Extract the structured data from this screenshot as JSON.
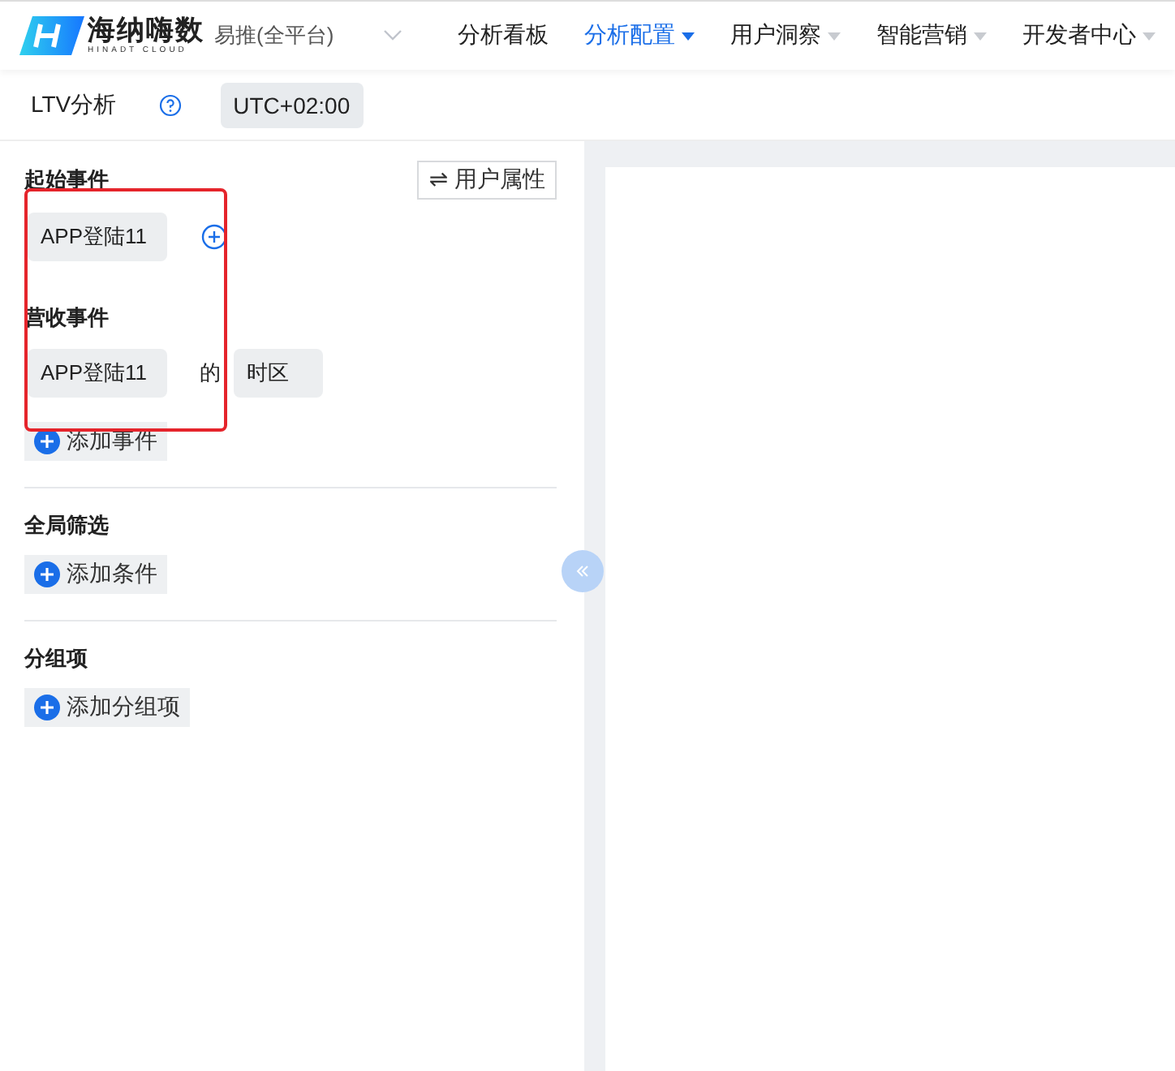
{
  "header": {
    "logo": {
      "name": "海纳嗨数",
      "subtitle": "HINADT CLOUD"
    },
    "project": "易推(全平台)",
    "nav": [
      {
        "label": "分析看板",
        "selected": false,
        "has_menu": false
      },
      {
        "label": "分析配置",
        "selected": true,
        "has_menu": true
      },
      {
        "label": "用户洞察",
        "selected": false,
        "has_menu": true
      },
      {
        "label": "智能营销",
        "selected": false,
        "has_menu": true
      },
      {
        "label": "开发者中心",
        "selected": false,
        "has_menu": true
      }
    ]
  },
  "toolbar": {
    "title": "LTV分析",
    "timezone": "UTC+02:00"
  },
  "panel": {
    "start_event": {
      "title": "起始事件",
      "switch_button": "⇌ 用户属性",
      "event": "APP登陆11"
    },
    "revenue_event": {
      "title": "营收事件",
      "event": "APP登陆11",
      "connector": "的",
      "property": "时区",
      "add_button": "添加事件"
    },
    "global_filter": {
      "title": "全局筛选",
      "add_button": "添加条件"
    },
    "grouping": {
      "title": "分组项",
      "add_button": "添加分组项"
    }
  },
  "annotation": {
    "kind": "highlight"
  }
}
